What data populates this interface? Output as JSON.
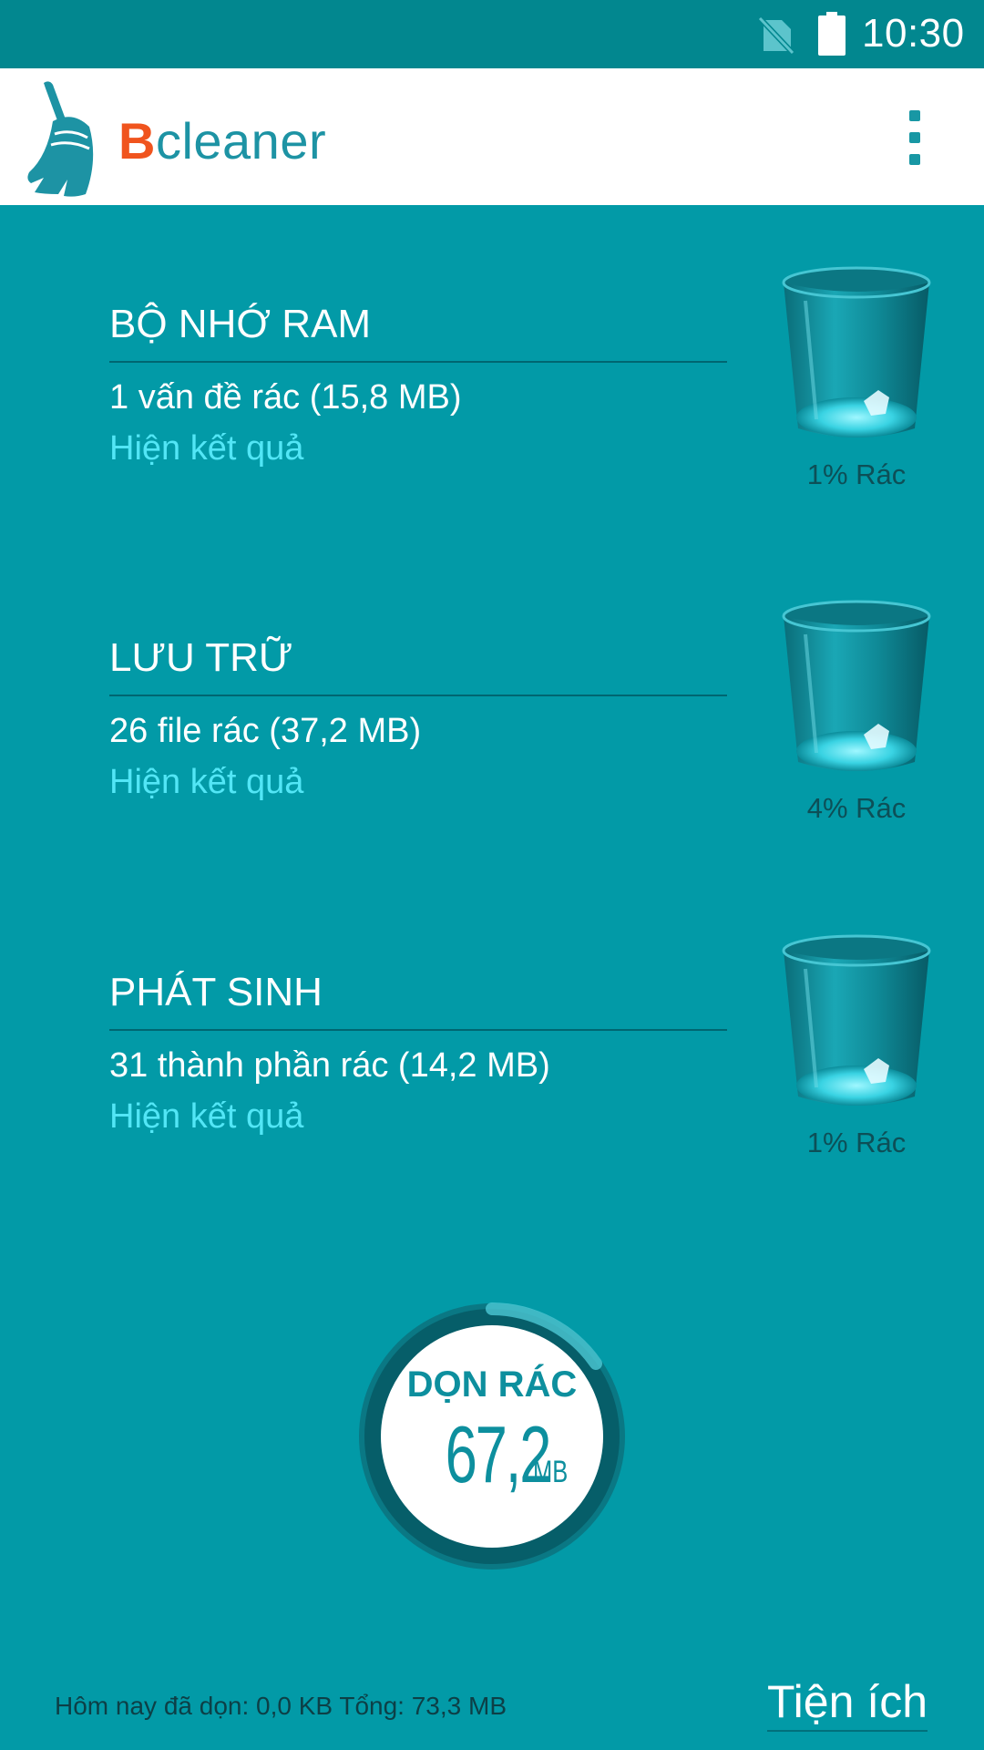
{
  "status_bar": {
    "time": "10:30",
    "icons": [
      "no-sim-icon",
      "battery-full-icon"
    ]
  },
  "app_bar": {
    "brand_first": "B",
    "brand_rest": "cleaner",
    "menu_icon": "more-vert-icon",
    "logo_icon": "broom-icon"
  },
  "sections": [
    {
      "title": "BỘ NHỚ RAM",
      "desc": "1 vấn đề rác (15,8 MB)",
      "link": "Hiện kết quả",
      "percent_label": "1% Rác",
      "percent": 1
    },
    {
      "title": "LƯU TRỮ",
      "desc": "26 file rác (37,2 MB)",
      "link": "Hiện kết quả",
      "percent_label": "4% Rác",
      "percent": 4
    },
    {
      "title": "PHÁT SINH",
      "desc": "31 thành phần rác (14,2 MB)",
      "link": "Hiện kết quả",
      "percent_label": "1% Rác",
      "percent": 1
    }
  ],
  "clean_button": {
    "label": "DỌN RÁC",
    "value": "67,2",
    "unit": "MB"
  },
  "footer": {
    "stats": "Hôm nay đã dọn: 0,0 KB Tổng: 73,3 MB",
    "tools_label": "Tiện ích"
  },
  "colors": {
    "background": "#029aa7",
    "status_bar": "#02878f",
    "brand_accent": "#f0541e",
    "brand_primary": "#1d93a4",
    "link": "#52e6f6"
  }
}
